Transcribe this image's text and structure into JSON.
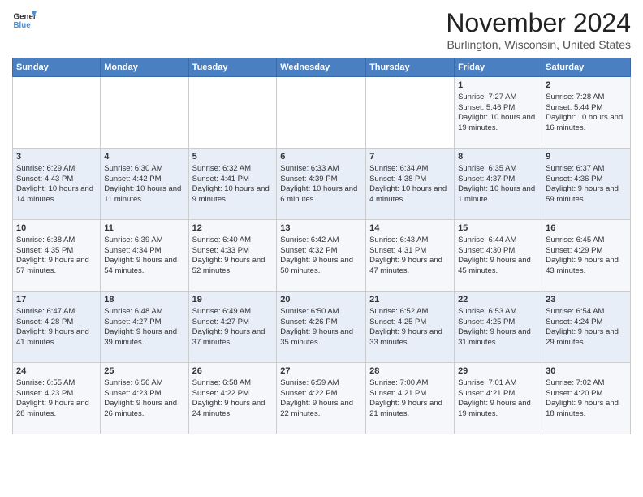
{
  "header": {
    "logo_line1": "General",
    "logo_line2": "Blue",
    "title": "November 2024",
    "subtitle": "Burlington, Wisconsin, United States"
  },
  "weekdays": [
    "Sunday",
    "Monday",
    "Tuesday",
    "Wednesday",
    "Thursday",
    "Friday",
    "Saturday"
  ],
  "weeks": [
    [
      {
        "day": "",
        "content": ""
      },
      {
        "day": "",
        "content": ""
      },
      {
        "day": "",
        "content": ""
      },
      {
        "day": "",
        "content": ""
      },
      {
        "day": "",
        "content": ""
      },
      {
        "day": "1",
        "content": "Sunrise: 7:27 AM\nSunset: 5:46 PM\nDaylight: 10 hours and 19 minutes."
      },
      {
        "day": "2",
        "content": "Sunrise: 7:28 AM\nSunset: 5:44 PM\nDaylight: 10 hours and 16 minutes."
      }
    ],
    [
      {
        "day": "3",
        "content": "Sunrise: 6:29 AM\nSunset: 4:43 PM\nDaylight: 10 hours and 14 minutes."
      },
      {
        "day": "4",
        "content": "Sunrise: 6:30 AM\nSunset: 4:42 PM\nDaylight: 10 hours and 11 minutes."
      },
      {
        "day": "5",
        "content": "Sunrise: 6:32 AM\nSunset: 4:41 PM\nDaylight: 10 hours and 9 minutes."
      },
      {
        "day": "6",
        "content": "Sunrise: 6:33 AM\nSunset: 4:39 PM\nDaylight: 10 hours and 6 minutes."
      },
      {
        "day": "7",
        "content": "Sunrise: 6:34 AM\nSunset: 4:38 PM\nDaylight: 10 hours and 4 minutes."
      },
      {
        "day": "8",
        "content": "Sunrise: 6:35 AM\nSunset: 4:37 PM\nDaylight: 10 hours and 1 minute."
      },
      {
        "day": "9",
        "content": "Sunrise: 6:37 AM\nSunset: 4:36 PM\nDaylight: 9 hours and 59 minutes."
      }
    ],
    [
      {
        "day": "10",
        "content": "Sunrise: 6:38 AM\nSunset: 4:35 PM\nDaylight: 9 hours and 57 minutes."
      },
      {
        "day": "11",
        "content": "Sunrise: 6:39 AM\nSunset: 4:34 PM\nDaylight: 9 hours and 54 minutes."
      },
      {
        "day": "12",
        "content": "Sunrise: 6:40 AM\nSunset: 4:33 PM\nDaylight: 9 hours and 52 minutes."
      },
      {
        "day": "13",
        "content": "Sunrise: 6:42 AM\nSunset: 4:32 PM\nDaylight: 9 hours and 50 minutes."
      },
      {
        "day": "14",
        "content": "Sunrise: 6:43 AM\nSunset: 4:31 PM\nDaylight: 9 hours and 47 minutes."
      },
      {
        "day": "15",
        "content": "Sunrise: 6:44 AM\nSunset: 4:30 PM\nDaylight: 9 hours and 45 minutes."
      },
      {
        "day": "16",
        "content": "Sunrise: 6:45 AM\nSunset: 4:29 PM\nDaylight: 9 hours and 43 minutes."
      }
    ],
    [
      {
        "day": "17",
        "content": "Sunrise: 6:47 AM\nSunset: 4:28 PM\nDaylight: 9 hours and 41 minutes."
      },
      {
        "day": "18",
        "content": "Sunrise: 6:48 AM\nSunset: 4:27 PM\nDaylight: 9 hours and 39 minutes."
      },
      {
        "day": "19",
        "content": "Sunrise: 6:49 AM\nSunset: 4:27 PM\nDaylight: 9 hours and 37 minutes."
      },
      {
        "day": "20",
        "content": "Sunrise: 6:50 AM\nSunset: 4:26 PM\nDaylight: 9 hours and 35 minutes."
      },
      {
        "day": "21",
        "content": "Sunrise: 6:52 AM\nSunset: 4:25 PM\nDaylight: 9 hours and 33 minutes."
      },
      {
        "day": "22",
        "content": "Sunrise: 6:53 AM\nSunset: 4:25 PM\nDaylight: 9 hours and 31 minutes."
      },
      {
        "day": "23",
        "content": "Sunrise: 6:54 AM\nSunset: 4:24 PM\nDaylight: 9 hours and 29 minutes."
      }
    ],
    [
      {
        "day": "24",
        "content": "Sunrise: 6:55 AM\nSunset: 4:23 PM\nDaylight: 9 hours and 28 minutes."
      },
      {
        "day": "25",
        "content": "Sunrise: 6:56 AM\nSunset: 4:23 PM\nDaylight: 9 hours and 26 minutes."
      },
      {
        "day": "26",
        "content": "Sunrise: 6:58 AM\nSunset: 4:22 PM\nDaylight: 9 hours and 24 minutes."
      },
      {
        "day": "27",
        "content": "Sunrise: 6:59 AM\nSunset: 4:22 PM\nDaylight: 9 hours and 22 minutes."
      },
      {
        "day": "28",
        "content": "Sunrise: 7:00 AM\nSunset: 4:21 PM\nDaylight: 9 hours and 21 minutes."
      },
      {
        "day": "29",
        "content": "Sunrise: 7:01 AM\nSunset: 4:21 PM\nDaylight: 9 hours and 19 minutes."
      },
      {
        "day": "30",
        "content": "Sunrise: 7:02 AM\nSunset: 4:20 PM\nDaylight: 9 hours and 18 minutes."
      }
    ]
  ]
}
